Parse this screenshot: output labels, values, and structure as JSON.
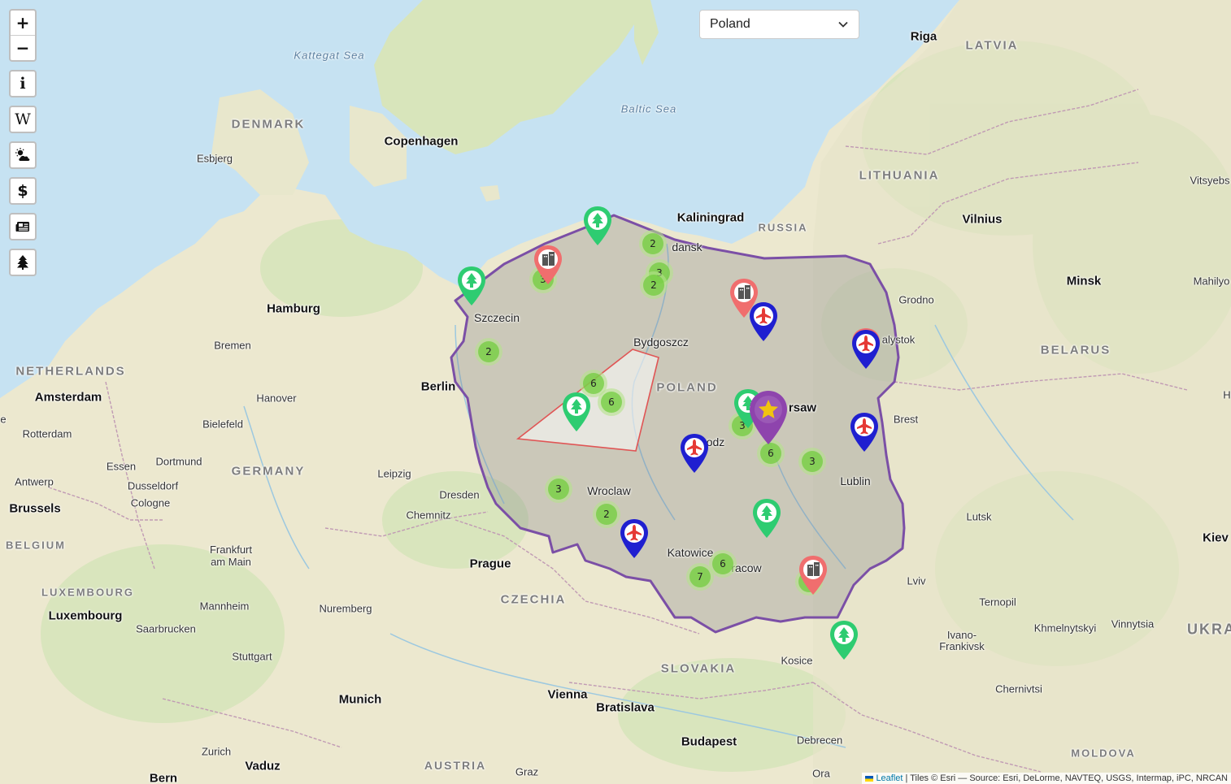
{
  "map": {
    "country_select": {
      "value": "Poland"
    },
    "zoom": {
      "in_label": "+",
      "out_label": "−"
    },
    "tools": [
      {
        "name": "info",
        "icon": "info-icon",
        "label": "i"
      },
      {
        "name": "wikipedia",
        "icon": "wikipedia-icon",
        "label": "W"
      },
      {
        "name": "weather",
        "icon": "weather-icon"
      },
      {
        "name": "currency",
        "icon": "dollar-icon",
        "label": "$"
      },
      {
        "name": "news",
        "icon": "newspaper-icon"
      },
      {
        "name": "parks",
        "icon": "tree-icon"
      }
    ],
    "labels": {
      "riga": "Riga",
      "latvia": "LATVIA",
      "kattegat": "Kattegat Sea",
      "baltic": "Baltic Sea",
      "denmark": "DENMARK",
      "copenhagen": "Copenhagen",
      "esbjerg": "Esbjerg",
      "lithuania": "LITHUANIA",
      "vitsyebsk": "Vitsyebs",
      "kaliningrad": "Kaliningrad",
      "russia": "RUSSIA",
      "vilnius": "Vilnius",
      "minsk": "Minsk",
      "mahilyo": "Mahilyo",
      "gdansk": "dansk",
      "grodno": "Grodno",
      "bialystok": "alystok",
      "hamburg": "Hamburg",
      "szczecin": "Szczecin",
      "bremen": "Bremen",
      "bydgoszcz": "Bydgoszcz",
      "belarus": "BELARUS",
      "netherlands": "NETHERLANDS",
      "amsterdam": "Amsterdam",
      "berlin": "Berlin",
      "poland": "POLAND",
      "hanover": "Hanover",
      "bielefeld": "Bielefeld",
      "warsaw": "rsaw",
      "brest": "Brest",
      "rotterdam": "Rotterdam",
      "lodz": "odz",
      "essen": "Essen",
      "dortmund": "Dortmund",
      "germany": "GERMANY",
      "leipzig": "Leipzig",
      "lublin": "Lublin",
      "antwerp": "Antwerp",
      "dusseldorf": "Dusseldorf",
      "dresden": "Dresden",
      "wroclaw": "Wroclaw",
      "brussels": "Brussels",
      "cologne": "Cologne",
      "chemnitz": "Chemnitz",
      "lutsk": "Lutsk",
      "belgium": "BELGIUM",
      "kiev": "Kiev",
      "frankfurt": "Frankfurt am Main",
      "prague": "Prague",
      "katowice": "Katowice",
      "krakow": "racow",
      "lviv": "Lviv",
      "luxembourg_c": "LUXEMBOURG",
      "czechia": "CZECHIA",
      "mannheim": "Mannheim",
      "nuremberg": "Nuremberg",
      "ternopil": "Ternopil",
      "luxembourg": "Luxembourg",
      "saarbrucken": "Saarbrucken",
      "khmelnytskyi": "Khmelnytskyi",
      "vinnytsia": "Vinnytsia",
      "ukraine": "UKRA",
      "ivano": "Ivano- Frankivsk",
      "stuttgart": "Stuttgart",
      "kosice": "Kosice",
      "slovakia": "SLOVAKIA",
      "munich": "Munich",
      "vienna": "Vienna",
      "chernivtsi": "Chernivtsi",
      "bratislava": "Bratislava",
      "zurich": "Zurich",
      "budapest": "Budapest",
      "debrecen": "Debrecen",
      "vaduz": "Vaduz",
      "austria": "AUSTRIA",
      "graz": "Graz",
      "moldova": "MOLDOVA",
      "bern": "Bern",
      "ora": "Ora",
      "h_edge": "H",
      "e_edge": "e"
    },
    "clusters": [
      {
        "id": "c1",
        "count": "2"
      },
      {
        "id": "c2",
        "count": "3"
      },
      {
        "id": "c3",
        "count": "2"
      },
      {
        "id": "c4",
        "count": "3"
      },
      {
        "id": "c5",
        "count": "2"
      },
      {
        "id": "c6",
        "count": "6"
      },
      {
        "id": "c7",
        "count": "6"
      },
      {
        "id": "c8",
        "count": "3"
      },
      {
        "id": "c9",
        "count": "6"
      },
      {
        "id": "c10",
        "count": "3"
      },
      {
        "id": "c11",
        "count": "3"
      },
      {
        "id": "c12",
        "count": "2"
      },
      {
        "id": "c13",
        "count": "6"
      },
      {
        "id": "c14",
        "count": "7"
      },
      {
        "id": "c15",
        "count": "4"
      }
    ],
    "marker_colors": {
      "park": "#2ecc71",
      "city": "#f06e6e",
      "airport": "#1f1fd0",
      "capital": "#8e44ad",
      "border": "#7b4fa6"
    },
    "attribution": {
      "leaflet": "Leaflet",
      "tiles": " | Tiles © Esri — Source: Esri, DeLorme, NAVTEQ, USGS, Intermap, iPC, NRCAN"
    }
  }
}
